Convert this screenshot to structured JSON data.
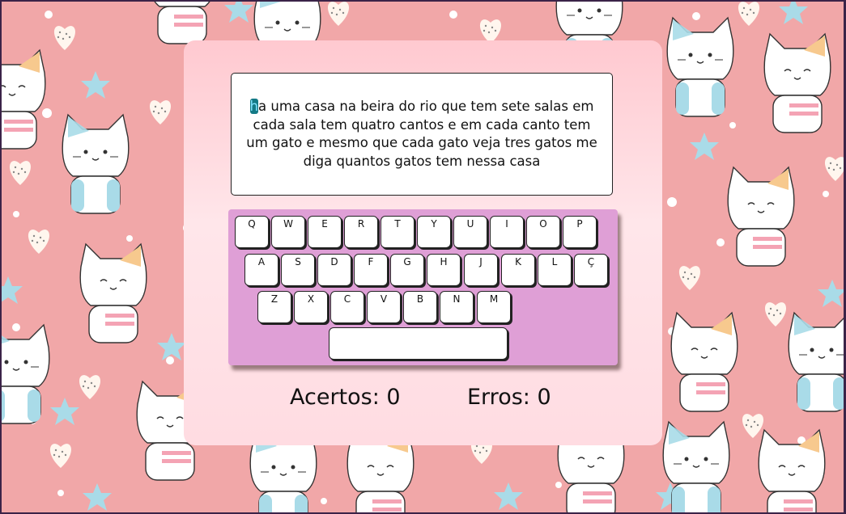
{
  "phrase": {
    "current_char": "h",
    "rest": "a uma casa na beira do rio que tem sete salas em cada sala tem quatro cantos e em cada canto tem um gato e mesmo que cada gato veja tres gatos me diga quantos gatos tem nessa casa"
  },
  "keyboard": {
    "row1": [
      "Q",
      "W",
      "E",
      "R",
      "T",
      "Y",
      "U",
      "I",
      "O",
      "P"
    ],
    "row2": [
      "A",
      "S",
      "D",
      "F",
      "G",
      "H",
      "J",
      "K",
      "L",
      "Ç"
    ],
    "row3": [
      "Z",
      "X",
      "C",
      "V",
      "B",
      "N",
      "M"
    ],
    "space_label": ""
  },
  "score": {
    "hits_label": "Acertos:",
    "hits_value": "0",
    "errors_label": "Erros:",
    "errors_value": "0"
  },
  "colors": {
    "background_pink": "#f1a7a8",
    "card_pink": "#ffdce2",
    "keyboard_purple": "#df9fd6",
    "cursor_teal": "#147a86"
  },
  "background_pattern": [
    "cat-icon",
    "heart-icon",
    "star-icon"
  ]
}
